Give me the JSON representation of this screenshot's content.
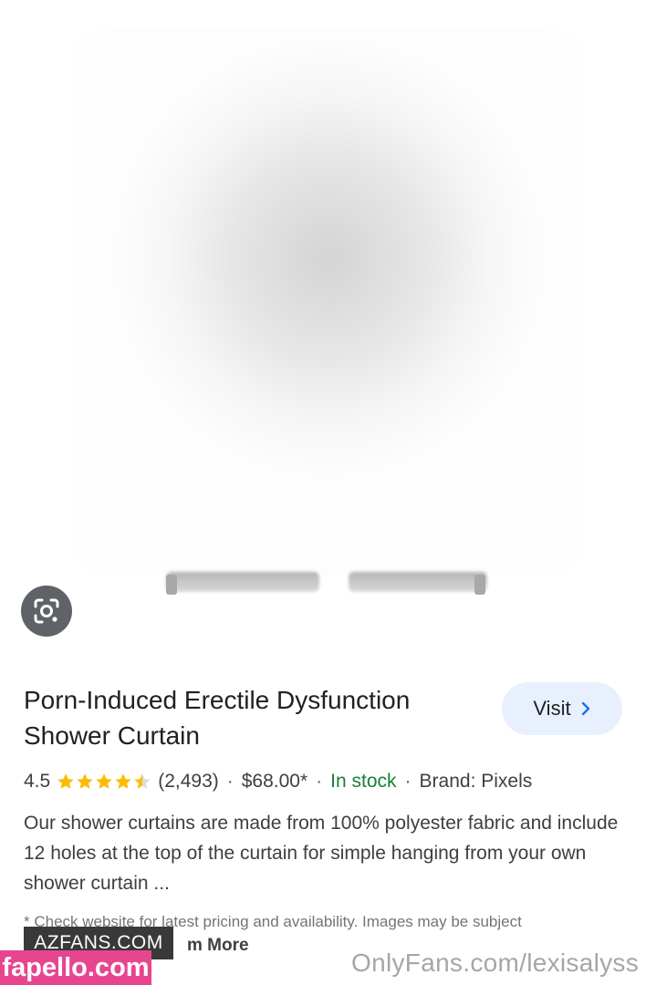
{
  "product": {
    "title": "Porn-Induced Erectile Dysfunction Shower Curtain",
    "visit_label": "Visit",
    "rating": "4.5",
    "rating_value": 4.5,
    "rating_max": 5,
    "review_count": "(2,493)",
    "price": "$68.00*",
    "stock": "In stock",
    "brand": "Brand: Pixels",
    "separator": "·",
    "description": "Our shower curtains are made from 100% polyester fabric and include 12 holes at the top of the curtain for simple hanging from your own shower curtain ...",
    "disclaimer": "* Check website for latest pricing and availability. Images may be subject",
    "learn_more": "m More"
  },
  "watermarks": {
    "azfans": "AZFANS.COM",
    "fapello": "fapello.com",
    "onlyfans": "OnlyFans.com/lexisalyss"
  },
  "colors": {
    "star": "#fbbc04",
    "in_stock": "#188038",
    "visit_bg": "#e8f0fe",
    "lens_bg": "#5f6368",
    "fapello_bg": "#e8458f"
  },
  "icons": {
    "lens": "google-lens-icon",
    "visit_arrow": "chevron-right-icon",
    "star": "star-icon"
  }
}
